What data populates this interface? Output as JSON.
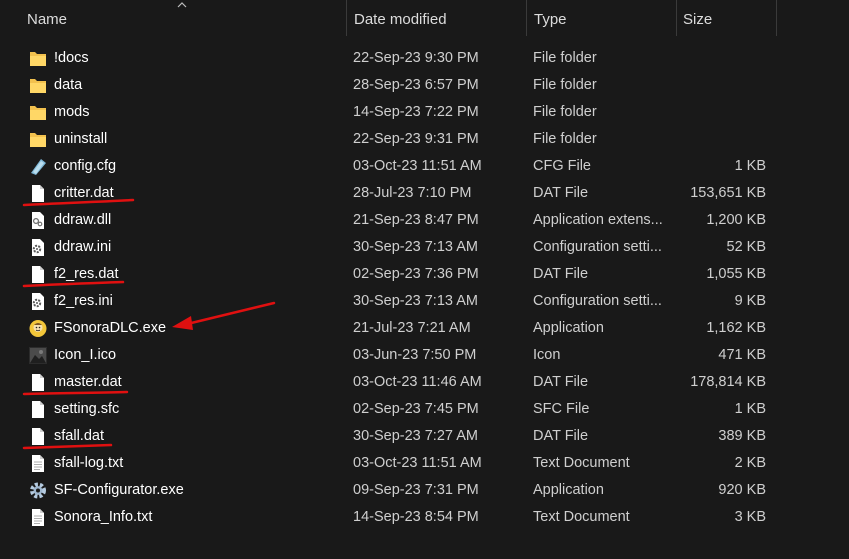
{
  "header": {
    "name": "Name",
    "date_modified": "Date modified",
    "type": "Type",
    "size": "Size"
  },
  "files": [
    {
      "name": "!docs",
      "date": "22-Sep-23 9:30 PM",
      "type": "File folder",
      "size": "",
      "icon": "folder-icon"
    },
    {
      "name": "data",
      "date": "28-Sep-23 6:57 PM",
      "type": "File folder",
      "size": "",
      "icon": "folder-icon"
    },
    {
      "name": "mods",
      "date": "14-Sep-23 7:22 PM",
      "type": "File folder",
      "size": "",
      "icon": "folder-icon"
    },
    {
      "name": "uninstall",
      "date": "22-Sep-23 9:31 PM",
      "type": "File folder",
      "size": "",
      "icon": "folder-icon"
    },
    {
      "name": "config.cfg",
      "date": "03-Oct-23 11:51 AM",
      "type": "CFG File",
      "size": "1 KB",
      "icon": "config-file-icon"
    },
    {
      "name": "critter.dat",
      "date": "28-Jul-23 7:10 PM",
      "type": "DAT File",
      "size": "153,651 KB",
      "icon": "blank-file-icon"
    },
    {
      "name": "ddraw.dll",
      "date": "21-Sep-23 8:47 PM",
      "type": "Application extens...",
      "size": "1,200 KB",
      "icon": "dll-file-icon"
    },
    {
      "name": "ddraw.ini",
      "date": "30-Sep-23 7:13 AM",
      "type": "Configuration setti...",
      "size": "52 KB",
      "icon": "settings-file-icon"
    },
    {
      "name": "f2_res.dat",
      "date": "02-Sep-23 7:36 PM",
      "type": "DAT File",
      "size": "1,055 KB",
      "icon": "blank-file-icon"
    },
    {
      "name": "f2_res.ini",
      "date": "30-Sep-23 7:13 AM",
      "type": "Configuration setti...",
      "size": "9 KB",
      "icon": "settings-file-icon"
    },
    {
      "name": "FSonoraDLC.exe",
      "date": "21-Jul-23 7:21 AM",
      "type": "Application",
      "size": "1,162 KB",
      "icon": "vault-boy-app-icon"
    },
    {
      "name": "Icon_I.ico",
      "date": "03-Jun-23 7:50 PM",
      "type": "Icon",
      "size": "471 KB",
      "icon": "image-icon"
    },
    {
      "name": "master.dat",
      "date": "03-Oct-23 11:46 AM",
      "type": "DAT File",
      "size": "178,814 KB",
      "icon": "blank-file-icon"
    },
    {
      "name": "setting.sfc",
      "date": "02-Sep-23 7:45 PM",
      "type": "SFC File",
      "size": "1 KB",
      "icon": "blank-file-icon"
    },
    {
      "name": "sfall.dat",
      "date": "30-Sep-23 7:27 AM",
      "type": "DAT File",
      "size": "389 KB",
      "icon": "blank-file-icon"
    },
    {
      "name": "sfall-log.txt",
      "date": "03-Oct-23 11:51 AM",
      "type": "Text Document",
      "size": "2 KB",
      "icon": "text-file-icon"
    },
    {
      "name": "SF-Configurator.exe",
      "date": "09-Sep-23 7:31 PM",
      "type": "Application",
      "size": "920 KB",
      "icon": "gear-icon"
    },
    {
      "name": "Sonora_Info.txt",
      "date": "14-Sep-23 8:54 PM",
      "type": "Text Document",
      "size": "3 KB",
      "icon": "text-file-icon"
    }
  ],
  "colors": {
    "background": "#191919",
    "annotation": "#e01010",
    "folder": "#f2c14e"
  }
}
